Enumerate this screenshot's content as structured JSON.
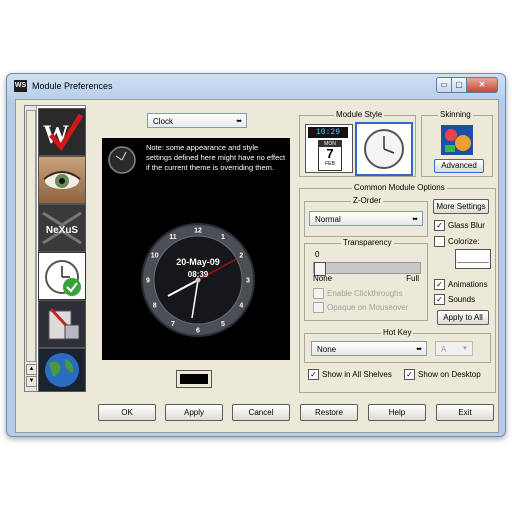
{
  "window": {
    "title": "Module Preferences",
    "app_icon_text": "WS",
    "min_symbol": "▭",
    "max_symbol": "▢",
    "close_symbol": "✕"
  },
  "sidebar": {
    "up_symbol": "▲",
    "down_symbol": "▼",
    "tile_logo": "WS",
    "tile_nexus": "NeXuS",
    "tile_count": 6
  },
  "module_select": {
    "value": "Clock",
    "arrow": "⬌"
  },
  "preview": {
    "note": "Note: some appearance and style settings defined here might have no effect if the current theme is overriding them.",
    "clock_date": "20-May-09",
    "clock_time": "08:39",
    "clock_numbers": [
      "12",
      "1",
      "2",
      "3",
      "4",
      "5",
      "6",
      "7",
      "8",
      "9",
      "10",
      "11"
    ]
  },
  "module_style": {
    "title": "Module Style",
    "digital_time": "10:29",
    "cal_day": "MON",
    "cal_date": "7",
    "cal_month": "FEB"
  },
  "skinning": {
    "title": "Skinning",
    "advanced_label": "Advanced"
  },
  "common": {
    "title": "Common Module Options",
    "zorder_title": "Z-Order",
    "zorder_value": "Normal",
    "more_settings": "More Settings",
    "glass_blur": "Glass Blur",
    "colorize": "Colorize:",
    "transparency_title": "Transparency",
    "transparency_value": "0",
    "transparency_level": 0.0,
    "none_label": "None",
    "full_label": "Full",
    "enable_clickthroughs": "Enable Clickthroughs",
    "opaque_mouseover": "Opaque on Mouseover",
    "animations": "Animations",
    "sounds": "Sounds",
    "apply_to_all": "Apply to All",
    "hotkey_title": "Hot Key",
    "hotkey_value": "None",
    "hotkey_key": "A",
    "show_all_shelves": "Show in All Shelves",
    "show_desktop": "Show on Desktop",
    "check_mark": "✓"
  },
  "buttons": {
    "ok": "OK",
    "apply": "Apply",
    "cancel": "Cancel",
    "restore": "Restore",
    "help": "Help",
    "exit": "Exit"
  },
  "colors": {
    "accent_selected": "#316ac5",
    "titlebar": "#b5cce8",
    "clock_hand": "#cc1111"
  }
}
